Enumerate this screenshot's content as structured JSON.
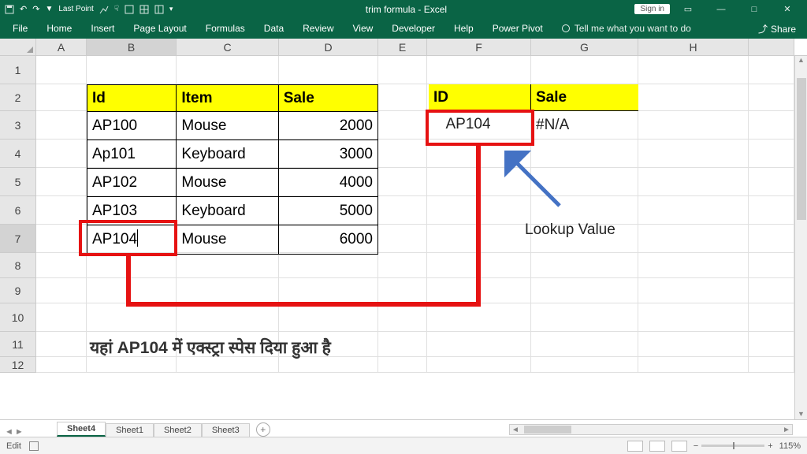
{
  "titlebar": {
    "qat_label": "Last Point",
    "title": "trim formula  -  Excel",
    "signin": "Sign in",
    "ribbon_opts": "⎯",
    "min": "—",
    "max": "□",
    "close": "✕"
  },
  "ribbon": {
    "tabs": [
      "File",
      "Home",
      "Insert",
      "Page Layout",
      "Formulas",
      "Data",
      "Review",
      "View",
      "Developer",
      "Help",
      "Power Pivot"
    ],
    "tellme": "Tell me what you want to do",
    "share": "Share"
  },
  "columns": [
    "A",
    "B",
    "C",
    "D",
    "E",
    "F",
    "G",
    "H"
  ],
  "rows": [
    "1",
    "2",
    "3",
    "4",
    "5",
    "6",
    "7",
    "8",
    "9",
    "10",
    "11",
    "12"
  ],
  "table1": {
    "headers": [
      "Id",
      "Item",
      "Sale"
    ],
    "rows": [
      [
        "AP100",
        "Mouse",
        "2000"
      ],
      [
        "Ap101",
        "Keyboard",
        "3000"
      ],
      [
        "AP102",
        "Mouse",
        "4000"
      ],
      [
        "AP103",
        "Keyboard",
        "5000"
      ],
      [
        "AP104 ",
        "Mouse",
        "6000"
      ]
    ]
  },
  "table2": {
    "headers": [
      "ID",
      "Sale"
    ],
    "lookup": "  AP104",
    "result": "#N/A"
  },
  "annotations": {
    "lookup_label": "Lookup Value",
    "note": "यहां AP104 में एक्स्ट्रा स्पेस दिया हुआ है"
  },
  "sheets": {
    "active": "Sheet4",
    "others": [
      "Sheet1",
      "Sheet2",
      "Sheet3"
    ]
  },
  "status": {
    "mode": "Edit",
    "zoom": "115%"
  }
}
